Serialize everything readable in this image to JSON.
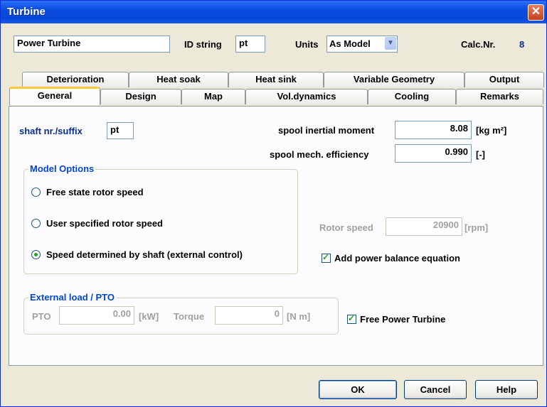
{
  "window": {
    "title": "Turbine",
    "close_glyph": "✕"
  },
  "header": {
    "name_value": "Power Turbine",
    "id_label": "ID string",
    "id_value": "pt",
    "units_label": "Units",
    "units_value": "As Model",
    "calc_label": "Calc.Nr.",
    "calc_value": "8"
  },
  "tabs_row1": [
    "Deterioration",
    "Heat soak",
    "Heat sink",
    "Variable Geometry",
    "Output"
  ],
  "tabs_row2": [
    "General",
    "Design",
    "Map",
    "Vol.dynamics",
    "Cooling",
    "Remarks"
  ],
  "general": {
    "shaft_label": "shaft nr./suffix",
    "shaft_value": "pt",
    "spool_moment_label": "spool inertial moment",
    "spool_moment_value": "8.08",
    "spool_moment_unit": "[kg m²]",
    "spool_eff_label": "spool mech. efficiency",
    "spool_eff_value": "0.990",
    "spool_eff_unit": "[-]",
    "model_options_title": "Model Options",
    "opt_free": "Free state rotor speed",
    "opt_user": "User specified rotor speed",
    "opt_shaft": "Speed determined by shaft (external control)",
    "rotor_speed_label": "Rotor speed",
    "rotor_speed_value": "20900",
    "rotor_speed_unit": "[rpm]",
    "add_power_label": "Add power balance equation",
    "external_title": "External load / PTO",
    "pto_label": "PTO",
    "pto_value": "0.00",
    "pto_unit": "[kW]",
    "torque_label": "Torque",
    "torque_value": "0",
    "torque_unit": "[N m]",
    "free_power_label": "Free Power Turbine"
  },
  "buttons": {
    "ok": "OK",
    "cancel": "Cancel",
    "help": "Help"
  },
  "colors": {
    "title_bar": "#0a4ce0",
    "accent_tab": "#ffc83c",
    "group_title": "#0046d5",
    "check": "#21a121"
  }
}
